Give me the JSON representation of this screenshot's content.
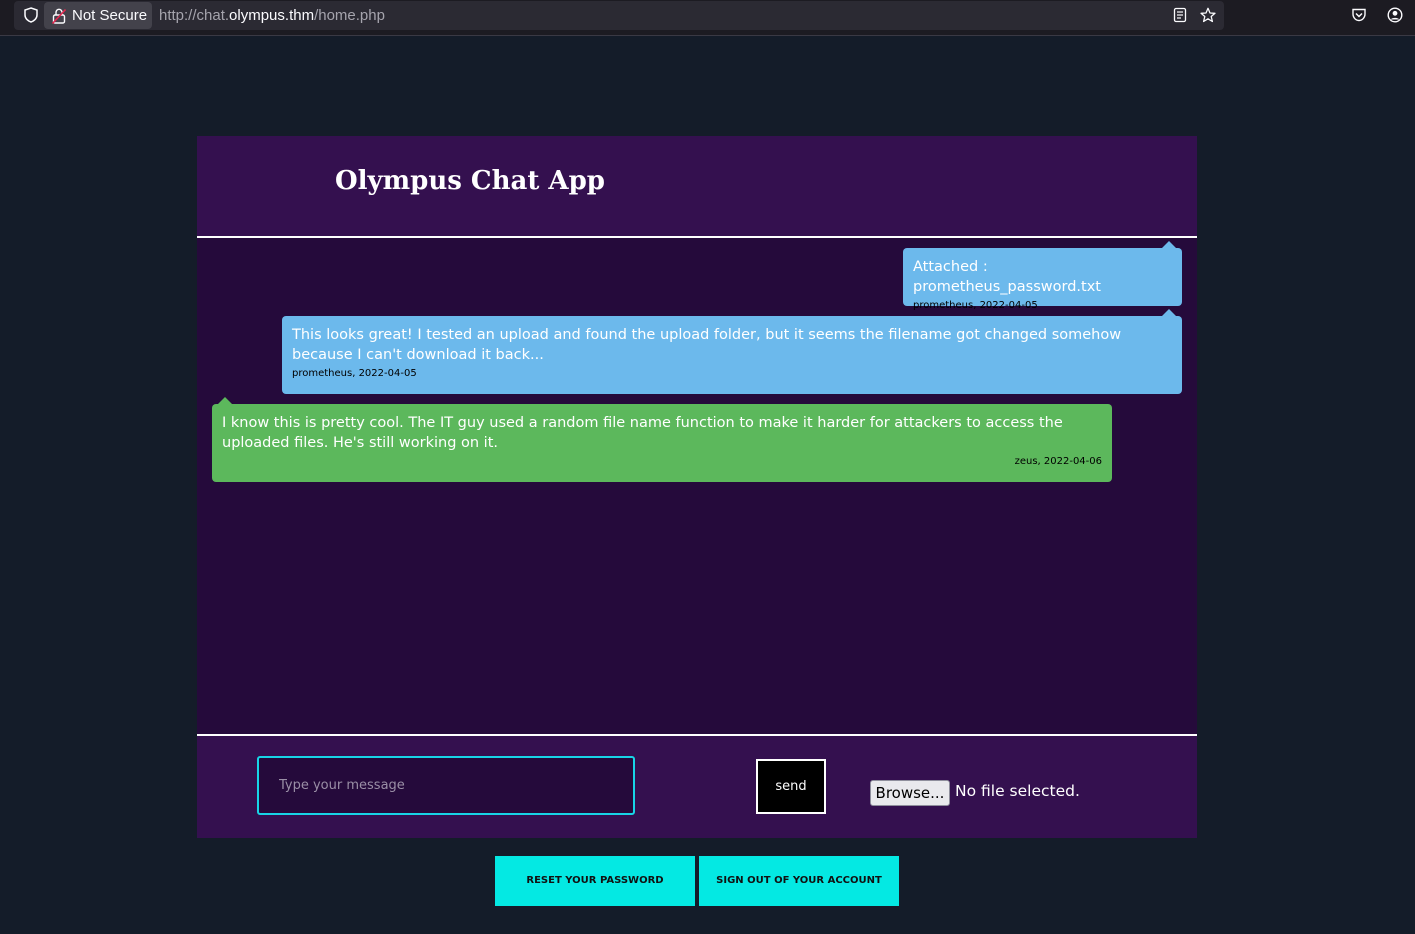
{
  "browser": {
    "security_label": "Not Secure",
    "url_prefix": "http://chat.",
    "url_domain": "olympus.thm",
    "url_path": "/home.php"
  },
  "chat": {
    "title": "Olympus Chat App",
    "messages": [
      {
        "text": "Attached : prometheus_password.txt",
        "meta": "prometheus, 2022-04-05",
        "color": "#6cb9ec"
      },
      {
        "text": "This looks great! I tested an upload and found the upload folder, but it seems the filename got changed somehow because I can't download it back...",
        "meta": "prometheus, 2022-04-05",
        "color": "#6cb9ec"
      },
      {
        "text": "I know this is pretty cool. The IT guy used a random file name function to make it harder for attackers to access the uploaded files. He's still working on it.",
        "meta": "zeus, 2022-04-06",
        "color": "#5cb85c"
      }
    ]
  },
  "composer": {
    "placeholder": "Type your message",
    "send_label": "send",
    "browse_label": "Browse...",
    "file_status": "No file selected."
  },
  "actions": {
    "reset_password": "RESET YOUR PASSWORD",
    "sign_out": "SIGN OUT OF YOUR ACCOUNT"
  },
  "colors": {
    "page_bg": "#141c29",
    "header_bg": "#34104f",
    "chat_bg": "#250a3b",
    "accent": "#04e9e3"
  }
}
